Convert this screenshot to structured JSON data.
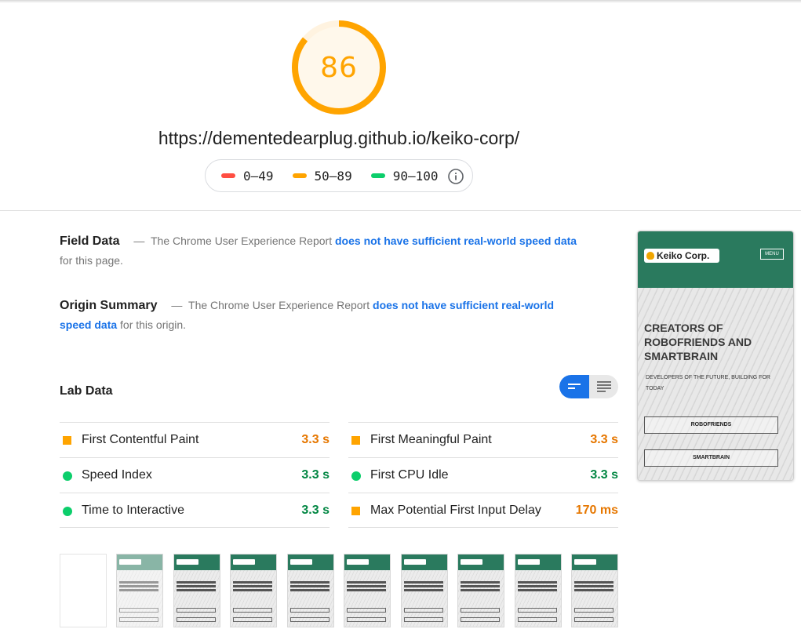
{
  "score": {
    "value": "86",
    "fraction": 0.86,
    "color": "#ffa400"
  },
  "url": "https://dementedearplug.github.io/keiko-corp/",
  "legend": {
    "ranges": [
      {
        "label": "0–49",
        "color": "#ff4e42"
      },
      {
        "label": "50–89",
        "color": "#ffa400"
      },
      {
        "label": "90–100",
        "color": "#0cce6b"
      }
    ]
  },
  "field_data": {
    "title": "Field Data",
    "dash": "—",
    "text": "The Chrome User Experience Report",
    "link": "does not have sufficient real-world speed data",
    "tail": "for this page."
  },
  "origin_summary": {
    "title": "Origin Summary",
    "dash": "—",
    "text": "The Chrome User Experience Report",
    "link": "does not have sufficient real-world speed data",
    "tail": "for this origin."
  },
  "lab_data": {
    "title": "Lab Data",
    "left_metrics": [
      {
        "label": "First Contentful Paint",
        "value": "3.3 s",
        "status": "average"
      },
      {
        "label": "Speed Index",
        "value": "3.3 s",
        "status": "pass"
      },
      {
        "label": "Time to Interactive",
        "value": "3.3 s",
        "status": "pass"
      }
    ],
    "right_metrics": [
      {
        "label": "First Meaningful Paint",
        "value": "3.3 s",
        "status": "average"
      },
      {
        "label": "First CPU Idle",
        "value": "3.3 s",
        "status": "pass"
      },
      {
        "label": "Max Potential First Input Delay",
        "value": "170 ms",
        "status": "average"
      }
    ]
  },
  "preview": {
    "logo": "Keiko Corp.",
    "menu": "MENU",
    "headline": "CREATORS OF ROBOFRIENDS AND SMARTBRAIN",
    "sub": "DEVELOPERS OF THE FUTURE, BUILDING FOR TODAY",
    "button_1": "ROBOFRIENDS",
    "button_2": "SMARTBRAIN"
  }
}
